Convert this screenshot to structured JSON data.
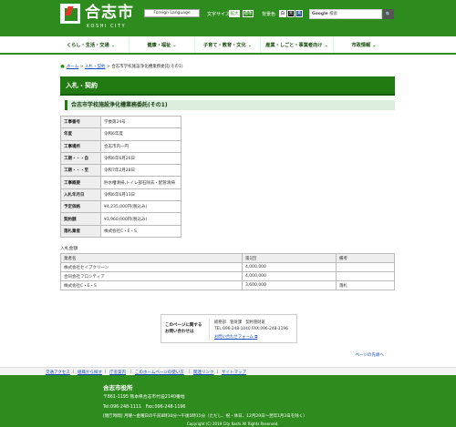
{
  "header": {
    "title": "合志市",
    "subtitle": "KOSHI CITY",
    "lang_label": "Foreign Language",
    "font_size_label": "文字サイズ",
    "font_large": "拡大",
    "font_std": "標準",
    "bg_color_label": "背景色",
    "bg_white": "白",
    "bg_black": "黒",
    "bg_blue": "青",
    "search_brand": "Google",
    "search_placeholder": "検索",
    "search_button": "🔍"
  },
  "nav": [
    "くらし・生活・交通",
    "健康・福祉",
    "子育て・教育・文化",
    "産業・しごと・事業者向け",
    "市政情報"
  ],
  "breadcrumb": {
    "home": "ホーム",
    "sep": ">",
    "parent": "入札・契約",
    "current": "合志市学校施設浄化槽業務委託(その1)"
  },
  "page_title": "入札・契約",
  "sub_title": "合志市学校施設浄化槽業務委託(その1)",
  "info_rows": [
    {
      "label": "工事番号",
      "value": "学委第24号"
    },
    {
      "label": "年度",
      "value": "令和6年度"
    },
    {
      "label": "工事場所",
      "value": "合志市内一円"
    },
    {
      "label": "工期・・・自",
      "value": "令和6年6月26日"
    },
    {
      "label": "工期・・・至",
      "value": "令和7年2月28日"
    },
    {
      "label": "工事概要",
      "value": "貯水槽清掃,トイレ部石除去・配管清掃"
    },
    {
      "label": "入札年月日",
      "value": "令和6年6月13日"
    },
    {
      "label": "予定価格",
      "value": "¥4,235,000円(税込み)"
    },
    {
      "label": "契約額",
      "value": "¥3,960,000円(税込み)"
    },
    {
      "label": "落札業者",
      "value": "株式会社C・E・S"
    }
  ],
  "bid_label": "入札金額",
  "bid_headers": [
    "業者名",
    "第1回",
    "備考"
  ],
  "bid_rows": [
    {
      "name": "株式会社セイブクリーン",
      "amount": "4,000,000",
      "note": ""
    },
    {
      "name": "合同会社フロンティア",
      "amount": "4,000,000",
      "note": ""
    },
    {
      "name": "株式会社C・E・S",
      "amount": "3,600,000",
      "note": "落札"
    }
  ],
  "contact": {
    "title": "このページに関するお問い合わせは",
    "dept": "総務部　管財課　契約管財班",
    "tel": "TEL:096-248-1040 FAX:096-248-1196",
    "form": "お問い合わせフォーム"
  },
  "to_top": "＾ページの先頭へ",
  "footer_links": [
    "交通アクセス",
    "組織から探す",
    "庁舎案内",
    "このホームページの使い方",
    "関連リンク",
    "サイトマップ"
  ],
  "footer": {
    "org": "合志市役所",
    "addr": "〒861-1195 熊本県合志市竹迫2140番地",
    "tel": "Tel:096-248-1111　Fax:096-248-1196",
    "hours": "[閉庁時間] 月曜〜金曜日の午前8時30分〜午後5時15分（ただし、祝・休日、12月29日〜翌年1月3日を除く）",
    "copyright": "Copyright (C) 2019 City Koshi All Rights Reserved."
  },
  "colors": {
    "brand_green": "#2e8b1e",
    "title_green": "#227a12",
    "link_blue": "#1a4dbf"
  }
}
